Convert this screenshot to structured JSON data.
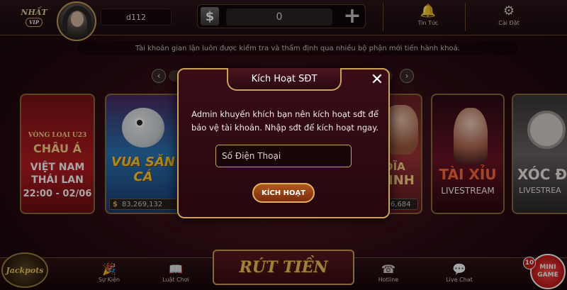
{
  "header": {
    "logo_text": "NHẤT",
    "logo_sub": "VIP",
    "username": "d112",
    "balance": "0",
    "currency_symbol": "$",
    "news_label": "Tin Tức",
    "settings_label": "Cài Đặt"
  },
  "notice": "Tài khoản gian lận luôn được kiểm tra và thẩm định qua nhiều bộ phận mới tiến hành khoá.",
  "games": [
    {
      "line1": "VÒNG LOẠI U23",
      "line2": "CHÂU Á",
      "line3": "VIỆT NAM",
      "line4": "THÁI LAN",
      "line5": "22:00 - 02/06"
    },
    {
      "title": "VUA SĂN CÁ",
      "value": "83,269,132",
      "currency": "$"
    },
    {
      "title1": "ĐĨA",
      "title2": "INH",
      "value": "6,684"
    },
    {
      "title": "TÀI XỈU",
      "subtitle": "LIVESTREAM"
    },
    {
      "title": "XÓC ĐĨ",
      "subtitle": "LIVESTREA"
    }
  ],
  "modal": {
    "title": "Kích Hoạt SĐT",
    "message": "Admin khuyến khích bạn nên kích hoạt sđt để bảo vệ tài khoản. Nhập sđt để kích hoạt ngay.",
    "phone_placeholder": "Số Điện Thoại",
    "activate_label": "KÍCH HOẠT"
  },
  "bottom": {
    "events_label": "Sự Kiện",
    "rules_label": "Luật Chơi",
    "withdraw_label": "RÚT TIỀN",
    "hotline_label": "Hotline",
    "livechat_label": "Live Chat",
    "jackpot_label": "Jackpots",
    "minigame_label1": "MINI",
    "minigame_label2": "GAME",
    "minigame_badge": "10"
  },
  "colors": {
    "gold": "#c9a15b",
    "background": "#2a0b12"
  }
}
